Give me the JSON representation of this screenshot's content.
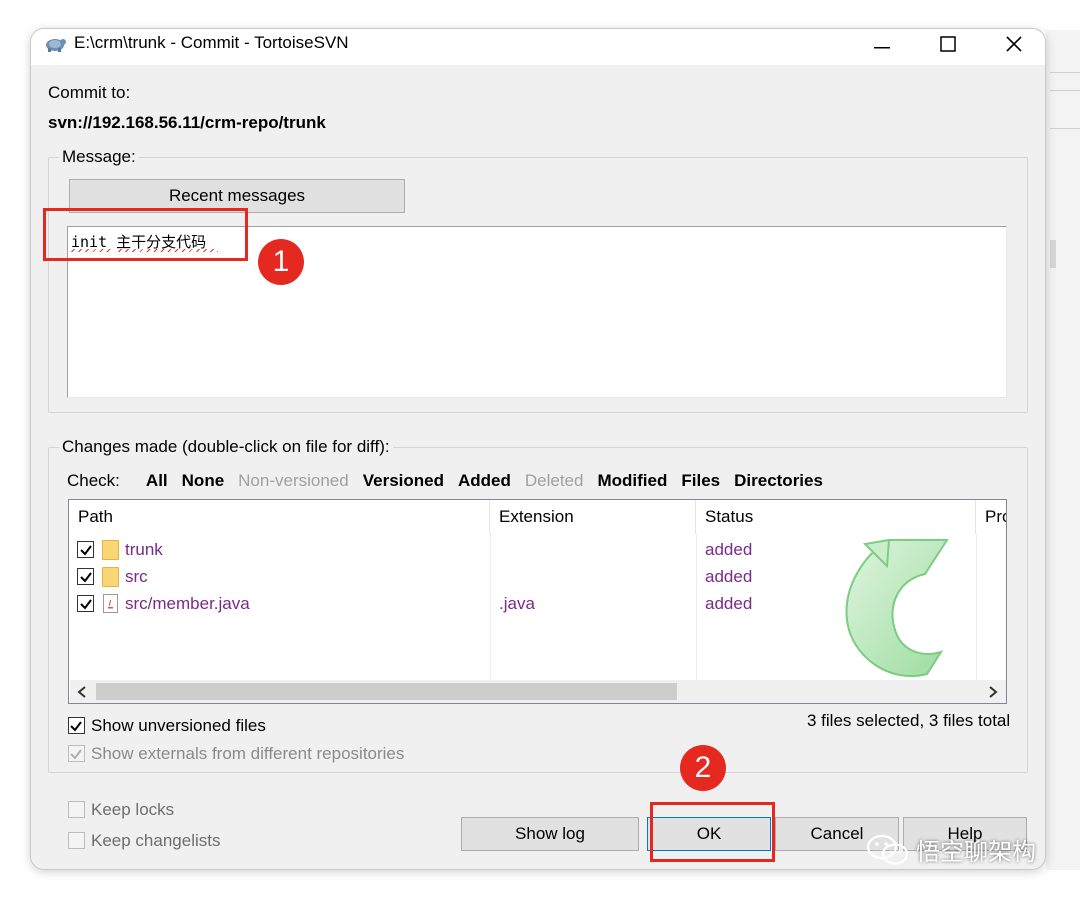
{
  "window": {
    "title": "E:\\crm\\trunk - Commit - TortoiseSVN",
    "controls": {
      "minimize": "—",
      "maximize": "☐",
      "close": "✕"
    }
  },
  "commit": {
    "label": "Commit to:",
    "url": "svn://192.168.56.11/crm-repo/trunk"
  },
  "message": {
    "group_label": "Message:",
    "recent_button": "Recent messages",
    "text": "init 主干分支代码"
  },
  "changes": {
    "group_label": "Changes made (double-click on file for diff):",
    "check_label": "Check:",
    "filters": [
      {
        "label": "All",
        "enabled": true
      },
      {
        "label": "None",
        "enabled": true
      },
      {
        "label": "Non-versioned",
        "enabled": false
      },
      {
        "label": "Versioned",
        "enabled": true
      },
      {
        "label": "Added",
        "enabled": true
      },
      {
        "label": "Deleted",
        "enabled": false
      },
      {
        "label": "Modified",
        "enabled": true
      },
      {
        "label": "Files",
        "enabled": true
      },
      {
        "label": "Directories",
        "enabled": true
      }
    ],
    "columns": [
      "Path",
      "Extension",
      "Status",
      "Pro"
    ],
    "rows": [
      {
        "path": "trunk",
        "extension": "",
        "status": "added",
        "icon": "folder-icon",
        "checked": true
      },
      {
        "path": "src",
        "extension": "",
        "status": "added",
        "icon": "folder-icon",
        "checked": true
      },
      {
        "path": "src/member.java",
        "extension": ".java",
        "status": "added",
        "icon": "java-file-icon",
        "checked": true
      }
    ],
    "show_unversioned": "Show unversioned files",
    "show_externals": "Show externals from different repositories",
    "summary": "3 files selected, 3 files total"
  },
  "options": {
    "keep_locks": "Keep locks",
    "keep_changelists": "Keep changelists"
  },
  "buttons": {
    "show_log": "Show log",
    "ok": "OK",
    "cancel": "Cancel",
    "help": "Help"
  },
  "annotations": {
    "step1": "1",
    "step2": "2"
  },
  "watermark": {
    "text": "悟空聊架构",
    "icon": "wechat-icon"
  },
  "colors": {
    "accent_red": "#e52820",
    "status_purple": "#7a2a8a",
    "folder_yellow": "#f8d774"
  }
}
